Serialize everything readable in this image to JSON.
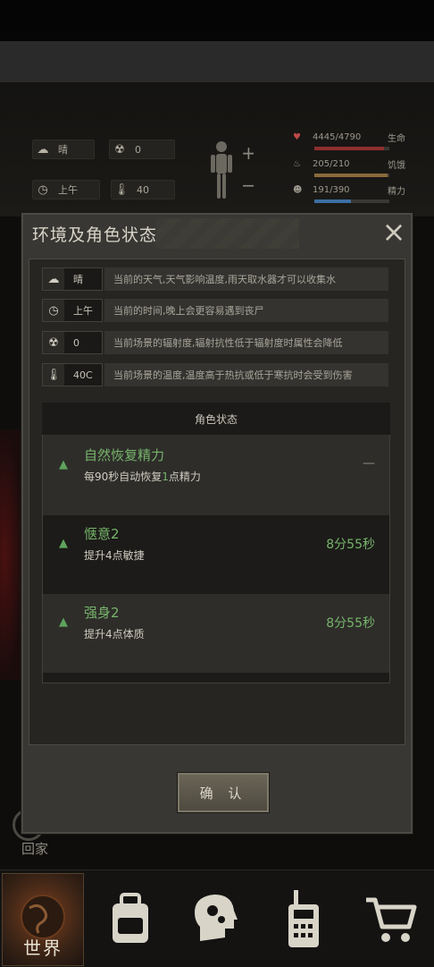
{
  "hud": {
    "weather_value": "晴",
    "radiation_value": "0",
    "time_value": "上午",
    "temperature_value": "40",
    "health_value": "4445/4790",
    "health_label": "生命",
    "health_fraction": 0.93,
    "hunger_value": "205/210",
    "hunger_label": "饥饿",
    "hunger_fraction": 0.98,
    "energy_value": "191/390",
    "energy_label": "精力",
    "energy_fraction": 0.49,
    "colors": {
      "health": "#8e2e2e",
      "hunger": "#8a6a3b",
      "energy": "#3b6fa3"
    }
  },
  "dialog": {
    "title": "环境及角色状态",
    "close_icon": "close-icon",
    "env": [
      {
        "icon": "weather-icon",
        "glyph": "☁",
        "value": "晴",
        "desc": "当前的天气,天气影响温度,雨天取水器才可以收集水"
      },
      {
        "icon": "clock-icon",
        "glyph": "◷",
        "value": "上午",
        "desc": "当前的时间,晚上会更容易遇到丧尸"
      },
      {
        "icon": "radiation-icon",
        "glyph": "☢",
        "value": "0",
        "desc": "当前场景的辐射度,辐射抗性低于辐射度时属性会降低"
      },
      {
        "icon": "thermometer-icon",
        "glyph": "🌡",
        "value": "40C",
        "desc": "当前场景的温度,温度高于热抗或低于寒抗时会受到伤害"
      }
    ],
    "state_header": "角色状态",
    "states": [
      {
        "name": "自然恢复精力",
        "desc_prefix": "每90秒自动恢复",
        "desc_highlight": "1",
        "desc_suffix": "点精力",
        "time": "—"
      },
      {
        "name": "惬意2",
        "desc": "提升4点敏捷",
        "time": "8分55秒"
      },
      {
        "name": "强身2",
        "desc": "提升4点体质",
        "time": "8分55秒"
      }
    ],
    "confirm_label": "确 认"
  },
  "background": {
    "home_label": "回家"
  },
  "nav": {
    "world_label": "世界",
    "items": [
      "globe-icon",
      "backpack-icon",
      "head-gears-icon",
      "walkie-talkie-icon",
      "cart-icon"
    ]
  }
}
